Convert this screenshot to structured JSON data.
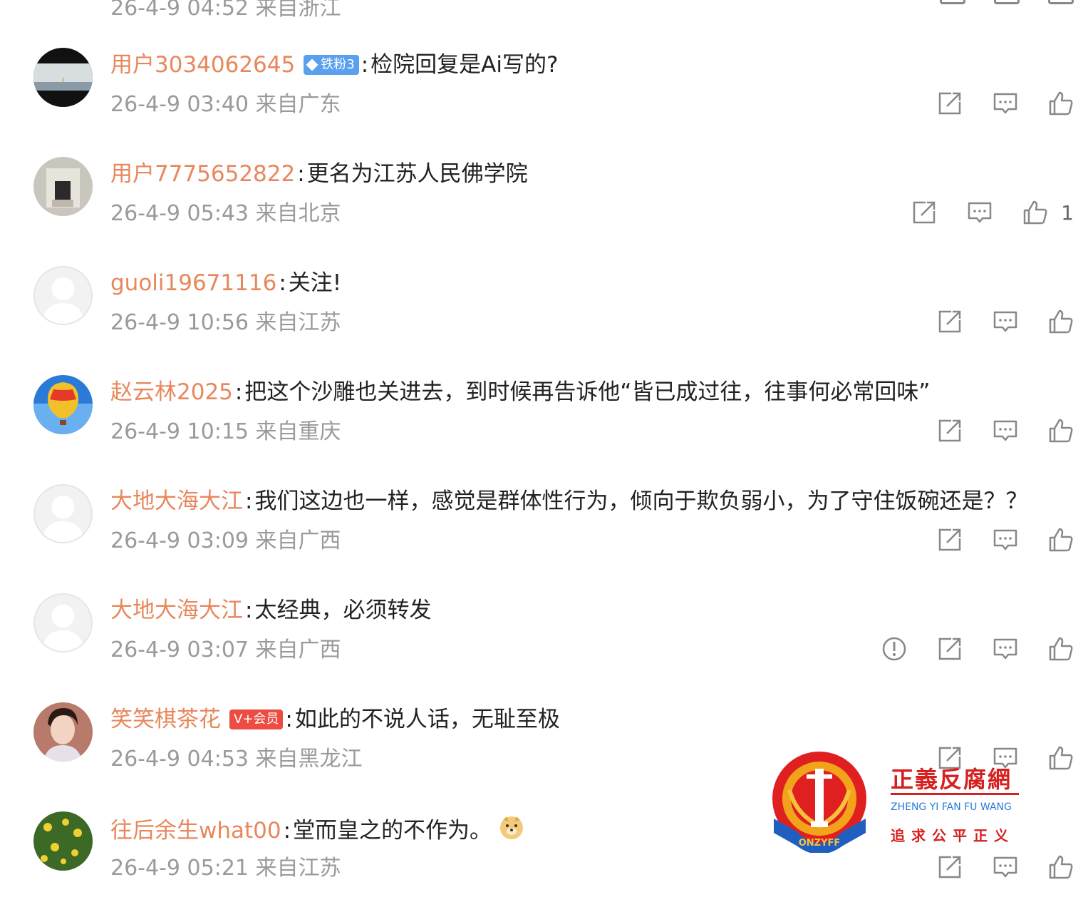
{
  "colors": {
    "username": "#e8875c",
    "meta": "#9a9a9a",
    "fan_badge": "#5aa0ee",
    "vip_badge": "#ec4c42",
    "watermark_red": "#d6201f",
    "watermark_blue": "#2b7bd6"
  },
  "partial_top": {
    "text": "26-4-9 04:52 来自浙江"
  },
  "comments": [
    {
      "username": "用户3034062645",
      "badge": "铁粉3",
      "badge_type": "fan",
      "text": "检院回复是Ai写的?",
      "time": "26-4-9 03:40",
      "location": "来自广东",
      "likes": "",
      "avatar": "landscape"
    },
    {
      "username": "用户7775652822",
      "badge": "",
      "badge_type": "",
      "text": "更名为江苏人民佛学院",
      "time": "26-4-9 05:43",
      "location": "来自北京",
      "likes": "1",
      "avatar": "building"
    },
    {
      "username": "guoli19671116",
      "badge": "",
      "badge_type": "",
      "text": "关注!",
      "time": "26-4-9 10:56",
      "location": "来自江苏",
      "likes": "",
      "avatar": "default"
    },
    {
      "username": "赵云林2025",
      "badge": "",
      "badge_type": "",
      "text": "把这个沙雕也关进去，到时候再告诉他“皆已成过往，往事何必常回味”",
      "time": "26-4-9 10:15",
      "location": "来自重庆",
      "likes": "",
      "avatar": "balloon"
    },
    {
      "username": "大地大海大江",
      "badge": "",
      "badge_type": "",
      "text": "我们这边也一样，感觉是群体性行为，倾向于欺负弱小，为了守住饭碗还是？？",
      "time": "26-4-9 03:09",
      "location": "来自广西",
      "likes": "",
      "avatar": "default"
    },
    {
      "username": "大地大海大江",
      "badge": "",
      "badge_type": "",
      "text": "太经典，必须转发",
      "time": "26-4-9 03:07",
      "location": "来自广西",
      "likes": "",
      "avatar": "default",
      "report": true
    },
    {
      "username": "笑笑棋茶花",
      "badge": "V+会员",
      "badge_type": "vip",
      "text": "如此的不说人话，无耻至极",
      "time": "26-4-9 04:53",
      "location": "来自黑龙江",
      "likes": "",
      "avatar": "woman"
    },
    {
      "username": "往后余生what00",
      "badge": "",
      "badge_type": "",
      "text": "堂而皇之的不作为。",
      "emoji": "doge-emoji",
      "time": "26-4-9 05:21",
      "location": "来自江苏",
      "likes": "",
      "avatar": "flowers"
    }
  ],
  "icons": {
    "share": "share-icon",
    "comment": "comment-icon",
    "like": "thumbs-up-icon",
    "report": "report-icon"
  },
  "watermark": {
    "title": "正義反腐網",
    "pinyin": "ZHENG YI FAN FU WANG",
    "slogan": "追求公平正义",
    "logo_text": "ONZYFF"
  }
}
